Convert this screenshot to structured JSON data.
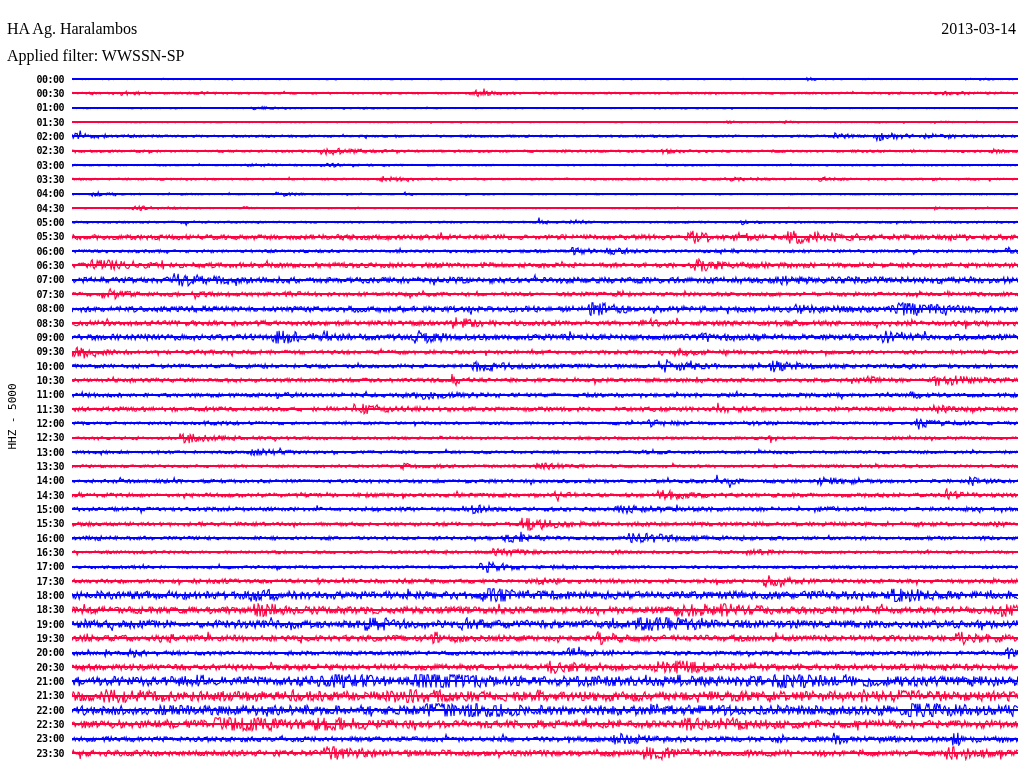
{
  "station": "HA Ag. Haralambos",
  "date": "2013-03-14",
  "filter": "Applied filter: WWSSN-SP",
  "axis_label": "HHZ - 5000",
  "rows": [
    {
      "time": "00:00",
      "color": "#0000ff"
    },
    {
      "time": "00:30",
      "color": "#ff0040"
    },
    {
      "time": "01:00",
      "color": "#0000ff"
    },
    {
      "time": "01:30",
      "color": "#ff0040"
    },
    {
      "time": "02:00",
      "color": "#0000ff"
    },
    {
      "time": "02:30",
      "color": "#ff0040"
    },
    {
      "time": "03:00",
      "color": "#0000ff"
    },
    {
      "time": "03:30",
      "color": "#ff0040"
    },
    {
      "time": "04:00",
      "color": "#0000ff"
    },
    {
      "time": "04:30",
      "color": "#ff0040"
    },
    {
      "time": "05:00",
      "color": "#0000ff"
    },
    {
      "time": "05:30",
      "color": "#ff0040"
    },
    {
      "time": "06:00",
      "color": "#0000ff"
    },
    {
      "time": "06:30",
      "color": "#ff0040"
    },
    {
      "time": "07:00",
      "color": "#0000ff"
    },
    {
      "time": "07:30",
      "color": "#ff0040"
    },
    {
      "time": "08:00",
      "color": "#0000ff"
    },
    {
      "time": "08:30",
      "color": "#ff0040"
    },
    {
      "time": "09:00",
      "color": "#0000ff"
    },
    {
      "time": "09:30",
      "color": "#ff0040"
    },
    {
      "time": "10:00",
      "color": "#0000ff"
    },
    {
      "time": "10:30",
      "color": "#ff0040"
    },
    {
      "time": "11:00",
      "color": "#0000ff"
    },
    {
      "time": "11:30",
      "color": "#ff0040"
    },
    {
      "time": "12:00",
      "color": "#0000ff"
    },
    {
      "time": "12:30",
      "color": "#ff0040"
    },
    {
      "time": "13:00",
      "color": "#0000ff"
    },
    {
      "time": "13:30",
      "color": "#ff0040"
    },
    {
      "time": "14:00",
      "color": "#0000ff"
    },
    {
      "time": "14:30",
      "color": "#ff0040"
    },
    {
      "time": "15:00",
      "color": "#0000ff"
    },
    {
      "time": "15:30",
      "color": "#ff0040"
    },
    {
      "time": "16:00",
      "color": "#0000ff"
    },
    {
      "time": "16:30",
      "color": "#ff0040"
    },
    {
      "time": "17:00",
      "color": "#0000ff"
    },
    {
      "time": "17:30",
      "color": "#ff0040"
    },
    {
      "time": "18:00",
      "color": "#0000ff"
    },
    {
      "time": "18:30",
      "color": "#ff0040"
    },
    {
      "time": "19:00",
      "color": "#0000ff"
    },
    {
      "time": "19:30",
      "color": "#ff0040"
    },
    {
      "time": "20:00",
      "color": "#0000ff"
    },
    {
      "time": "20:30",
      "color": "#ff0040"
    },
    {
      "time": "21:00",
      "color": "#0000ff"
    },
    {
      "time": "21:30",
      "color": "#ff0040"
    },
    {
      "time": "22:00",
      "color": "#0000ff"
    },
    {
      "time": "22:30",
      "color": "#ff0040"
    },
    {
      "time": "23:00",
      "color": "#0000ff"
    },
    {
      "time": "23:30",
      "color": "#ff0040"
    }
  ]
}
